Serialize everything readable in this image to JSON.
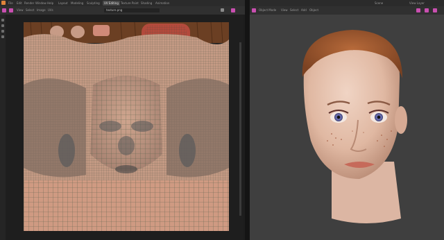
{
  "topbar": {
    "menu": [
      "File",
      "Edit",
      "Render",
      "Window",
      "Help"
    ],
    "tabs": [
      "Layout",
      "Modeling",
      "Sculpting",
      "UV Editing",
      "Texture Paint",
      "Shading",
      "Animation"
    ],
    "active_tab": "UV Editing",
    "scene_label": "Scene",
    "viewlayer_label": "View Layer"
  },
  "uv_editor": {
    "header_labels": [
      "View",
      "Select",
      "Image",
      "UVs"
    ],
    "image_name": "texture.png"
  },
  "viewport": {
    "header_labels": [
      "Object Mode",
      "View",
      "Select",
      "Add",
      "Object"
    ]
  },
  "colors": {
    "accent": "#c94fb0",
    "uv_background": "#b98f7a",
    "viewport_background": "#3f3f3f"
  },
  "icons": [
    "blender-logo-icon",
    "uv-editor-icon",
    "viewport-icon",
    "cursor-tool-icon"
  ]
}
